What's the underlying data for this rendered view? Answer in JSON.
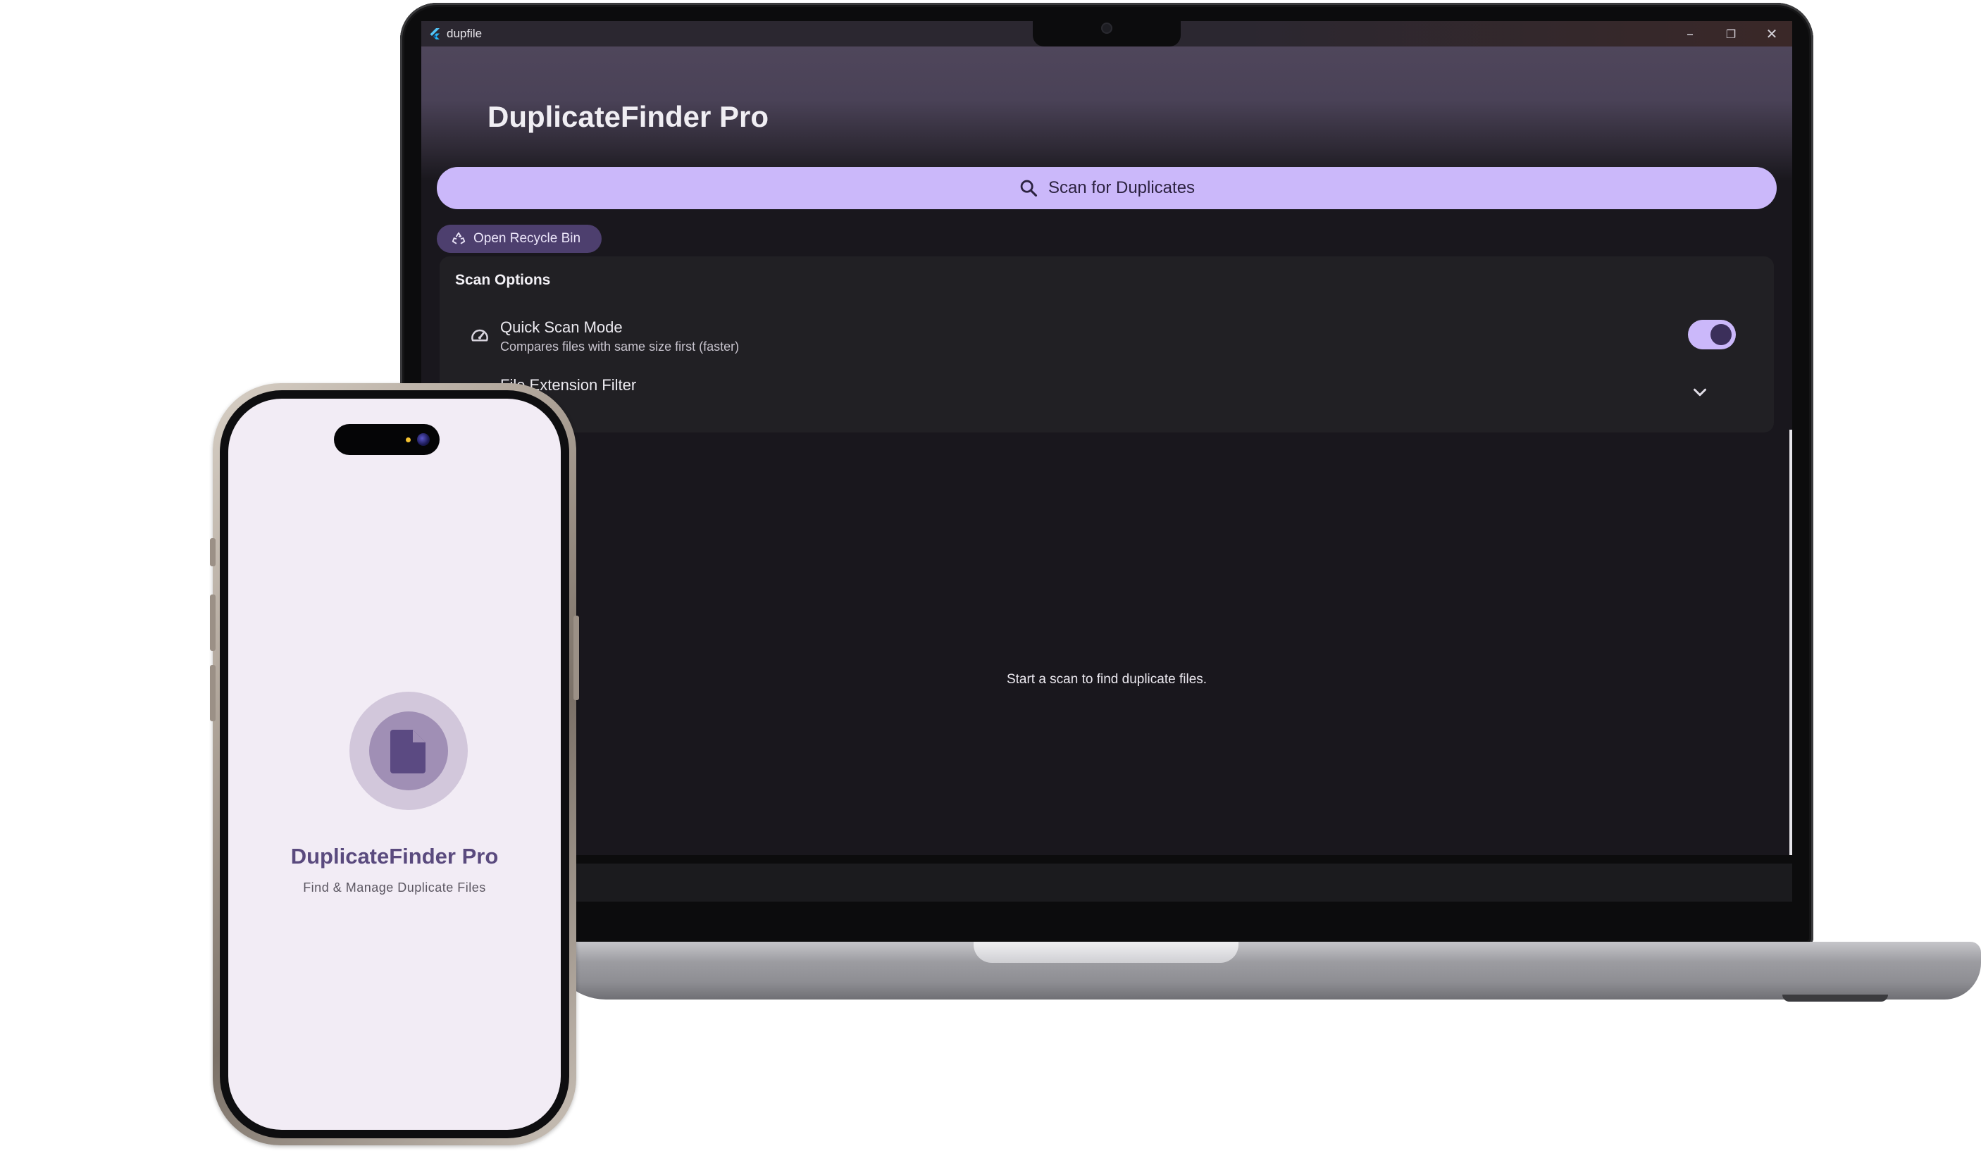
{
  "desktop": {
    "window_title": "dupfile",
    "controls": {
      "minimize": "–",
      "restore": "❐",
      "close": "✕"
    },
    "app_title": "DuplicateFinder Pro",
    "scan_button_label": "Scan for Duplicates",
    "recycle_button_label": "Open Recycle Bin",
    "scan_options": {
      "title": "Scan Options",
      "quick_scan": {
        "label": "Quick Scan Mode",
        "description": "Compares files with same size first (faster)",
        "enabled": true
      },
      "extension_filter": {
        "label": "File Extension Filter",
        "expanded": false
      }
    },
    "empty_message": "Start a scan to find duplicate files."
  },
  "mobile": {
    "app_title": "DuplicateFinder Pro",
    "subtitle": "Find & Manage Duplicate Files"
  },
  "icons": {
    "app": "flutter-icon",
    "search": "search-icon",
    "recycle": "recycle-icon",
    "speed": "speedometer-icon",
    "chevron": "chevron-down-icon",
    "file": "file-icon"
  },
  "colors": {
    "accent": "#cbb8fa",
    "chip": "#4d3f6e",
    "background": "#19171d",
    "card": "#212024",
    "phone_bg": "#f2ecf5",
    "phone_title": "#5a4a7e"
  }
}
